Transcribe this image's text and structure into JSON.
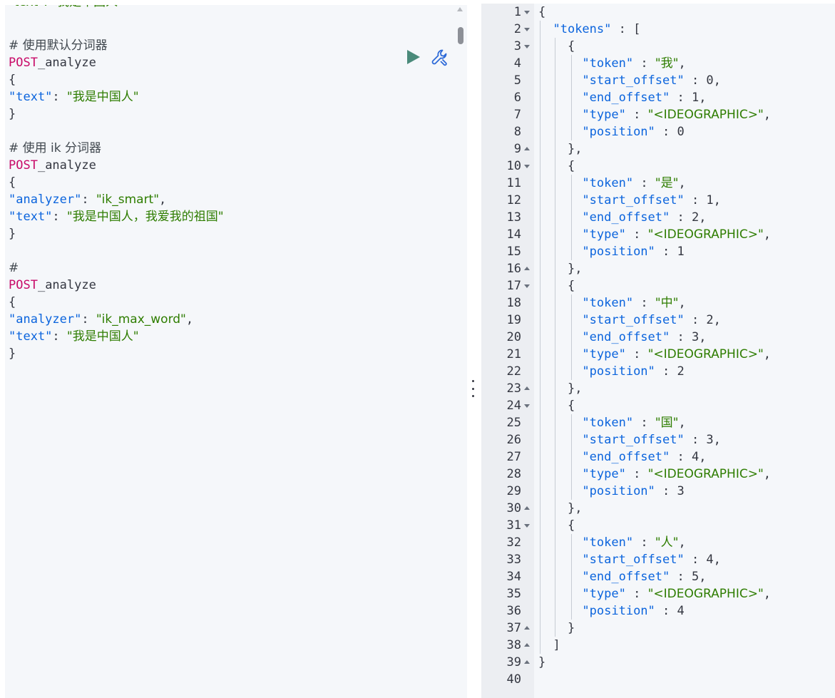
{
  "request_editor": {
    "lines": [
      {
        "type": "partial",
        "text": "\"text\": \"我是中国人\""
      },
      {
        "type": "blank"
      },
      {
        "type": "comment",
        "text": "# 使用默认分词器"
      },
      {
        "type": "request",
        "method": "POST",
        "path": "_analyze"
      },
      {
        "type": "brace",
        "text": "{",
        "marker": true
      },
      {
        "type": "kv",
        "key": "\"text\"",
        "value": "\"我是中国人\"",
        "comma": false
      },
      {
        "type": "brace",
        "text": "}",
        "marker": true
      },
      {
        "type": "blank"
      },
      {
        "type": "comment",
        "text": "# 使用 ik 分词器"
      },
      {
        "type": "request",
        "method": "POST",
        "path": "_analyze"
      },
      {
        "type": "brace",
        "text": "{",
        "marker": true
      },
      {
        "type": "kv",
        "key": "\"analyzer\"",
        "value": "\"ik_smart\"",
        "comma": true
      },
      {
        "type": "kv",
        "key": "\"text\"",
        "value": "\"我是中国人，我爱我的祖国\"",
        "comma": false
      },
      {
        "type": "brace",
        "text": "}",
        "marker": true
      },
      {
        "type": "blank"
      },
      {
        "type": "comment",
        "text": "#"
      },
      {
        "type": "request",
        "method": "POST",
        "path": "_analyze"
      },
      {
        "type": "brace",
        "text": "{",
        "marker": true
      },
      {
        "type": "kv",
        "key": "\"analyzer\"",
        "value": "\"ik_max_word\"",
        "comma": true
      },
      {
        "type": "kv",
        "key": "\"text\"",
        "value": "\"我是中国人\"",
        "comma": false
      },
      {
        "type": "brace",
        "text": "}",
        "marker": true
      }
    ],
    "icons": {
      "run": "play-icon",
      "settings": "wrench-icon"
    },
    "colors": {
      "run": "#4a8a7a",
      "wrench": "#2e6ad8"
    }
  },
  "divider": {
    "icon": "vertical-ellipsis-icon"
  },
  "response_viewer": {
    "lines": [
      {
        "n": "1",
        "fold": "down",
        "indent": 0,
        "parts": [
          [
            "p",
            "{"
          ]
        ]
      },
      {
        "n": "2",
        "fold": "down",
        "indent": 1,
        "parts": [
          [
            "k",
            "\"tokens\""
          ],
          [
            "p",
            " : ["
          ]
        ]
      },
      {
        "n": "3",
        "fold": "down",
        "indent": 2,
        "parts": [
          [
            "p",
            "{"
          ]
        ]
      },
      {
        "n": "4",
        "fold": "",
        "indent": 3,
        "parts": [
          [
            "k",
            "\"token\""
          ],
          [
            "p",
            " : "
          ],
          [
            "s",
            "\"我\""
          ],
          [
            "p",
            ","
          ]
        ]
      },
      {
        "n": "5",
        "fold": "",
        "indent": 3,
        "parts": [
          [
            "k",
            "\"start_offset\""
          ],
          [
            "p",
            " : 0,"
          ]
        ]
      },
      {
        "n": "6",
        "fold": "",
        "indent": 3,
        "parts": [
          [
            "k",
            "\"end_offset\""
          ],
          [
            "p",
            " : 1,"
          ]
        ]
      },
      {
        "n": "7",
        "fold": "",
        "indent": 3,
        "parts": [
          [
            "k",
            "\"type\""
          ],
          [
            "p",
            " : "
          ],
          [
            "s",
            "\"<IDEOGRAPHIC>\""
          ],
          [
            "p",
            ","
          ]
        ]
      },
      {
        "n": "8",
        "fold": "",
        "indent": 3,
        "parts": [
          [
            "k",
            "\"position\""
          ],
          [
            "p",
            " : 0"
          ]
        ]
      },
      {
        "n": "9",
        "fold": "up",
        "indent": 2,
        "parts": [
          [
            "p",
            "},"
          ]
        ]
      },
      {
        "n": "10",
        "fold": "down",
        "indent": 2,
        "parts": [
          [
            "p",
            "{"
          ]
        ]
      },
      {
        "n": "11",
        "fold": "",
        "indent": 3,
        "parts": [
          [
            "k",
            "\"token\""
          ],
          [
            "p",
            " : "
          ],
          [
            "s",
            "\"是\""
          ],
          [
            "p",
            ","
          ]
        ]
      },
      {
        "n": "12",
        "fold": "",
        "indent": 3,
        "parts": [
          [
            "k",
            "\"start_offset\""
          ],
          [
            "p",
            " : 1,"
          ]
        ]
      },
      {
        "n": "13",
        "fold": "",
        "indent": 3,
        "parts": [
          [
            "k",
            "\"end_offset\""
          ],
          [
            "p",
            " : 2,"
          ]
        ]
      },
      {
        "n": "14",
        "fold": "",
        "indent": 3,
        "parts": [
          [
            "k",
            "\"type\""
          ],
          [
            "p",
            " : "
          ],
          [
            "s",
            "\"<IDEOGRAPHIC>\""
          ],
          [
            "p",
            ","
          ]
        ]
      },
      {
        "n": "15",
        "fold": "",
        "indent": 3,
        "parts": [
          [
            "k",
            "\"position\""
          ],
          [
            "p",
            " : 1"
          ]
        ]
      },
      {
        "n": "16",
        "fold": "up",
        "indent": 2,
        "parts": [
          [
            "p",
            "},"
          ]
        ]
      },
      {
        "n": "17",
        "fold": "down",
        "indent": 2,
        "parts": [
          [
            "p",
            "{"
          ]
        ]
      },
      {
        "n": "18",
        "fold": "",
        "indent": 3,
        "parts": [
          [
            "k",
            "\"token\""
          ],
          [
            "p",
            " : "
          ],
          [
            "s",
            "\"中\""
          ],
          [
            "p",
            ","
          ]
        ]
      },
      {
        "n": "19",
        "fold": "",
        "indent": 3,
        "parts": [
          [
            "k",
            "\"start_offset\""
          ],
          [
            "p",
            " : 2,"
          ]
        ]
      },
      {
        "n": "20",
        "fold": "",
        "indent": 3,
        "parts": [
          [
            "k",
            "\"end_offset\""
          ],
          [
            "p",
            " : 3,"
          ]
        ]
      },
      {
        "n": "21",
        "fold": "",
        "indent": 3,
        "parts": [
          [
            "k",
            "\"type\""
          ],
          [
            "p",
            " : "
          ],
          [
            "s",
            "\"<IDEOGRAPHIC>\""
          ],
          [
            "p",
            ","
          ]
        ]
      },
      {
        "n": "22",
        "fold": "",
        "indent": 3,
        "parts": [
          [
            "k",
            "\"position\""
          ],
          [
            "p",
            " : 2"
          ]
        ]
      },
      {
        "n": "23",
        "fold": "up",
        "indent": 2,
        "parts": [
          [
            "p",
            "},"
          ]
        ]
      },
      {
        "n": "24",
        "fold": "down",
        "indent": 2,
        "parts": [
          [
            "p",
            "{"
          ]
        ]
      },
      {
        "n": "25",
        "fold": "",
        "indent": 3,
        "parts": [
          [
            "k",
            "\"token\""
          ],
          [
            "p",
            " : "
          ],
          [
            "s",
            "\"国\""
          ],
          [
            "p",
            ","
          ]
        ]
      },
      {
        "n": "26",
        "fold": "",
        "indent": 3,
        "parts": [
          [
            "k",
            "\"start_offset\""
          ],
          [
            "p",
            " : 3,"
          ]
        ]
      },
      {
        "n": "27",
        "fold": "",
        "indent": 3,
        "parts": [
          [
            "k",
            "\"end_offset\""
          ],
          [
            "p",
            " : 4,"
          ]
        ]
      },
      {
        "n": "28",
        "fold": "",
        "indent": 3,
        "parts": [
          [
            "k",
            "\"type\""
          ],
          [
            "p",
            " : "
          ],
          [
            "s",
            "\"<IDEOGRAPHIC>\""
          ],
          [
            "p",
            ","
          ]
        ]
      },
      {
        "n": "29",
        "fold": "",
        "indent": 3,
        "parts": [
          [
            "k",
            "\"position\""
          ],
          [
            "p",
            " : 3"
          ]
        ]
      },
      {
        "n": "30",
        "fold": "up",
        "indent": 2,
        "parts": [
          [
            "p",
            "},"
          ]
        ]
      },
      {
        "n": "31",
        "fold": "down",
        "indent": 2,
        "parts": [
          [
            "p",
            "{"
          ]
        ]
      },
      {
        "n": "32",
        "fold": "",
        "indent": 3,
        "parts": [
          [
            "k",
            "\"token\""
          ],
          [
            "p",
            " : "
          ],
          [
            "s",
            "\"人\""
          ],
          [
            "p",
            ","
          ]
        ]
      },
      {
        "n": "33",
        "fold": "",
        "indent": 3,
        "parts": [
          [
            "k",
            "\"start_offset\""
          ],
          [
            "p",
            " : 4,"
          ]
        ]
      },
      {
        "n": "34",
        "fold": "",
        "indent": 3,
        "parts": [
          [
            "k",
            "\"end_offset\""
          ],
          [
            "p",
            " : 5,"
          ]
        ]
      },
      {
        "n": "35",
        "fold": "",
        "indent": 3,
        "parts": [
          [
            "k",
            "\"type\""
          ],
          [
            "p",
            " : "
          ],
          [
            "s",
            "\"<IDEOGRAPHIC>\""
          ],
          [
            "p",
            ","
          ]
        ]
      },
      {
        "n": "36",
        "fold": "",
        "indent": 3,
        "parts": [
          [
            "k",
            "\"position\""
          ],
          [
            "p",
            " : 4"
          ]
        ]
      },
      {
        "n": "37",
        "fold": "up",
        "indent": 2,
        "parts": [
          [
            "p",
            "}"
          ]
        ]
      },
      {
        "n": "38",
        "fold": "up",
        "indent": 1,
        "parts": [
          [
            "p",
            "]"
          ]
        ]
      },
      {
        "n": "39",
        "fold": "up",
        "indent": 0,
        "parts": [
          [
            "p",
            "}"
          ]
        ]
      },
      {
        "n": "40",
        "fold": "",
        "indent": 0,
        "parts": []
      }
    ],
    "colors": {
      "key": "#0b64dd",
      "string": "#2e7d00",
      "punct": "#343741"
    }
  }
}
